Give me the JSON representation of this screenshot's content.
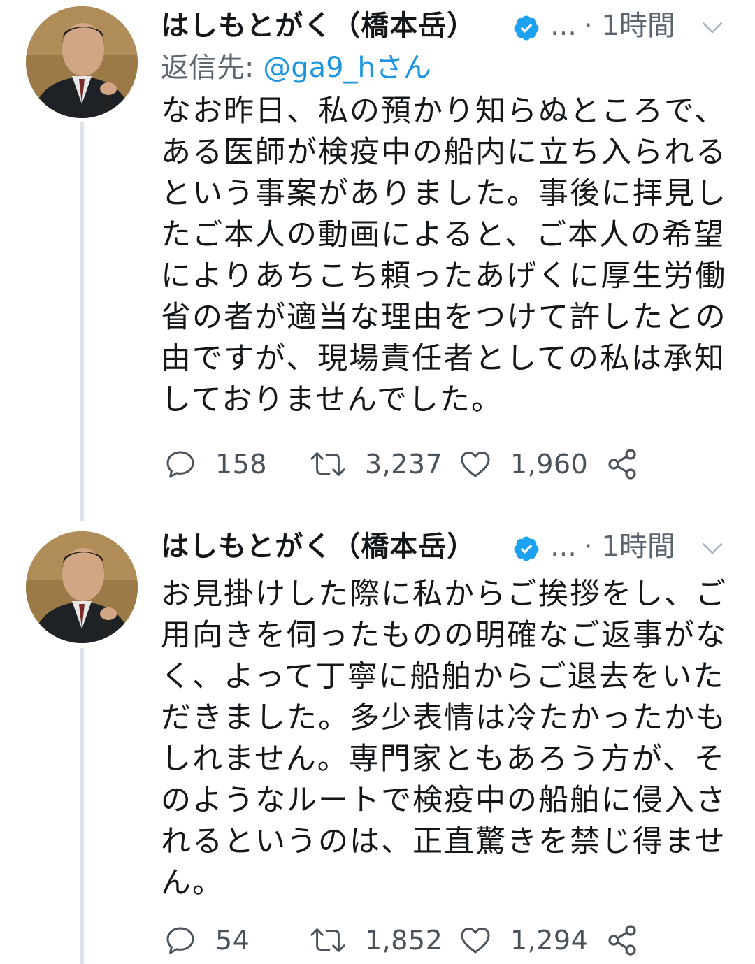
{
  "tweets": [
    {
      "author_name": "はしもとがく（橋本岳）",
      "verified_icon": "verified-badge-icon",
      "ellipsis": "…",
      "time": "· 1時間",
      "reply_to_prefix": "返信先: ",
      "reply_to_handle": "@ga9_hさん",
      "text": "なお昨日、私の預かり知らぬところで、\nある医師が検疫中の船内に立ち入られる\nという事案がありました。事後に拝見し\nたご本人の動画によると、ご本人の希望\nによりあちこち頼ったあげくに厚生労働\n省の者が適当な理由をつけて許したとの\n由ですが、現場責任者としての私は承知\nしておりませんでした。",
      "replies": "158",
      "retweets": "3,237",
      "likes": "1,960"
    },
    {
      "author_name": "はしもとがく（橋本岳）",
      "verified_icon": "verified-badge-icon",
      "ellipsis": "…",
      "time": "· 1時間",
      "text": "お見掛けした際に私からご挨拶をし、ご\n用向きを伺ったものの明確なご返事がな\nく、よって丁寧に船舶からご退去をいた\nだきました。多少表情は冷たかったかも\nしれません。専門家ともあろう方が、そ\nのようなルートで検疫中の船舶に侵入さ\nれるというのは、正直驚きを禁じ得ませ\nん。",
      "replies": "54",
      "retweets": "1,852",
      "likes": "1,294"
    }
  ],
  "colors": {
    "text": "#14171a",
    "secondary": "#5b6570",
    "link": "#1b95e0",
    "verified": "#1da1f2",
    "thread_line": "#dfe3e7"
  }
}
